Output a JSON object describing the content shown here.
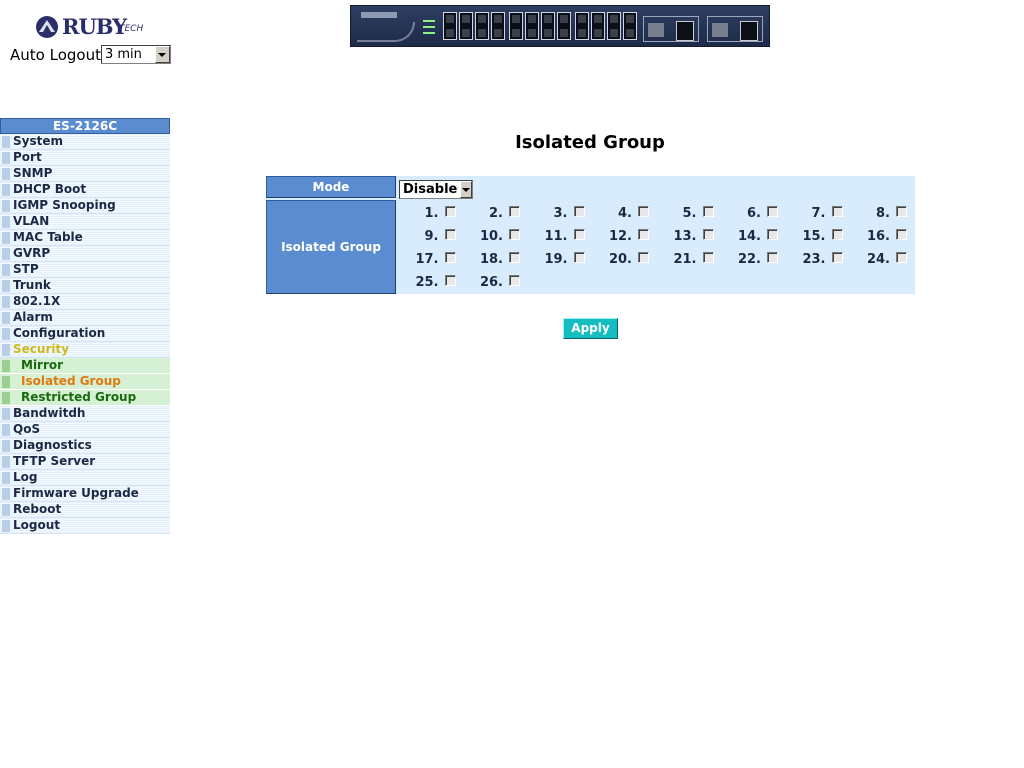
{
  "header": {
    "logo_text": "RUBY",
    "logo_suffix": "TECH",
    "auto_logout_label": "Auto Logout",
    "auto_logout_value": "3 min"
  },
  "sidebar": {
    "model": "ES-2126C",
    "items": [
      {
        "label": "System"
      },
      {
        "label": "Port"
      },
      {
        "label": "SNMP"
      },
      {
        "label": "DHCP Boot"
      },
      {
        "label": "IGMP Snooping"
      },
      {
        "label": "VLAN"
      },
      {
        "label": "MAC Table"
      },
      {
        "label": "GVRP"
      },
      {
        "label": "STP"
      },
      {
        "label": "Trunk"
      },
      {
        "label": "802.1X"
      },
      {
        "label": "Alarm"
      },
      {
        "label": "Configuration"
      },
      {
        "label": "Security"
      },
      {
        "label": "Mirror"
      },
      {
        "label": "Isolated Group"
      },
      {
        "label": "Restricted Group"
      },
      {
        "label": "Bandwitdh"
      },
      {
        "label": "QoS"
      },
      {
        "label": "Diagnostics"
      },
      {
        "label": "TFTP Server"
      },
      {
        "label": "Log"
      },
      {
        "label": "Firmware Upgrade"
      },
      {
        "label": "Reboot"
      },
      {
        "label": "Logout"
      }
    ]
  },
  "main": {
    "title": "Isolated Group",
    "mode_label": "Mode",
    "mode_value": "Disable",
    "group_label": "Isolated Group",
    "ports": [
      "1.",
      "2.",
      "3.",
      "4.",
      "5.",
      "6.",
      "7.",
      "8.",
      "9.",
      "10.",
      "11.",
      "12.",
      "13.",
      "14.",
      "15.",
      "16.",
      "17.",
      "18.",
      "19.",
      "20.",
      "21.",
      "22.",
      "23.",
      "24.",
      "25.",
      "26."
    ],
    "apply_label": "Apply"
  }
}
